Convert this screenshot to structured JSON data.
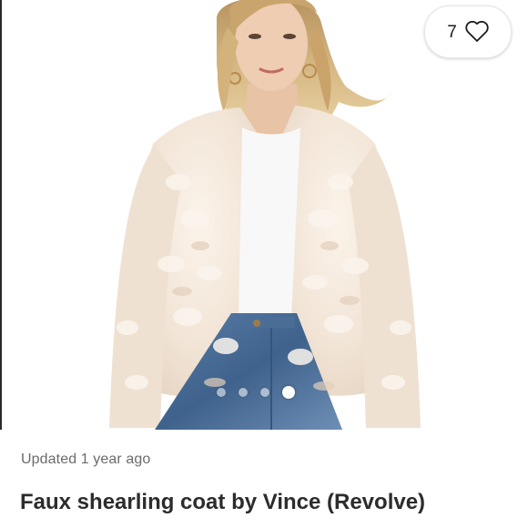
{
  "listing": {
    "like_count": "7",
    "updated_text": "Updated 1 year ago",
    "title": "Faux shearling coat by Vince (Revolve)"
  },
  "carousel": {
    "image_count": 4,
    "active_index": 3
  },
  "icons": {
    "like": "heart-outline-icon"
  },
  "colors": {
    "background": "#ffffff",
    "title": "#2c2c2c",
    "meta": "#6b6b6b",
    "coat": "#f3e7dc",
    "denim": "#4a6f9a"
  }
}
